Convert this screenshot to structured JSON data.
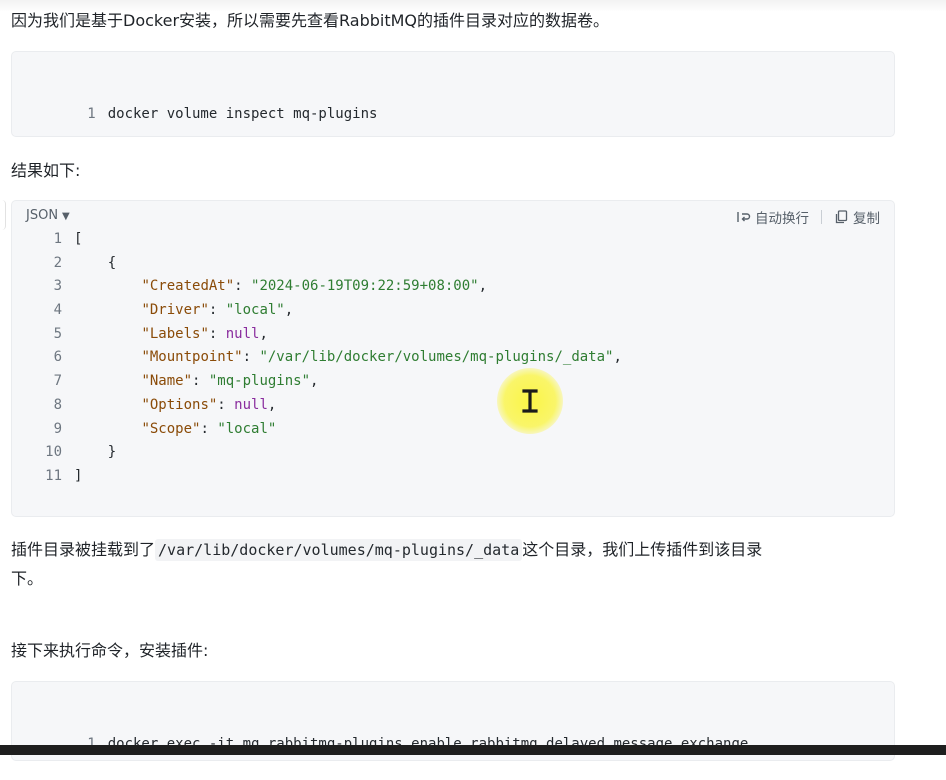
{
  "intro_text": "因为我们是基于Docker安装，所以需要先查看RabbitMQ的插件目录对应的数据卷。",
  "block1": {
    "lines": [
      {
        "num": "1",
        "text": "docker volume inspect mq-plugins"
      }
    ]
  },
  "result_label": "结果如下:",
  "json_block": {
    "lang": "JSON",
    "wrap_label": "自动换行",
    "copy_label": "复制",
    "lines": [
      {
        "num": "1",
        "indent": "",
        "open": "["
      },
      {
        "num": "2",
        "indent": "    ",
        "open": "{"
      },
      {
        "num": "3",
        "key": "\"CreatedAt\"",
        "val": "\"2024-06-19T09:22:59+08:00\"",
        "tail": ","
      },
      {
        "num": "4",
        "key": "\"Driver\"",
        "val": "\"local\"",
        "tail": ","
      },
      {
        "num": "5",
        "key": "\"Labels\"",
        "nul": "null",
        "tail": ","
      },
      {
        "num": "6",
        "key": "\"Mountpoint\"",
        "val": "\"/var/lib/docker/volumes/mq-plugins/_data\"",
        "tail": ","
      },
      {
        "num": "7",
        "key": "\"Name\"",
        "val": "\"mq-plugins\"",
        "tail": ","
      },
      {
        "num": "8",
        "key": "\"Options\"",
        "nul": "null",
        "tail": ","
      },
      {
        "num": "9",
        "key": "\"Scope\"",
        "val": "\"local\"",
        "tail": ""
      },
      {
        "num": "10",
        "indent": "    ",
        "open": "}"
      },
      {
        "num": "11",
        "indent": "",
        "open": "]"
      }
    ]
  },
  "mount_para": {
    "before": "插件目录被挂载到了",
    "code": "/var/lib/docker/volumes/mq-plugins/_data",
    "after": "这个目录，我们上传插件到该目录",
    "line2": "下。"
  },
  "next_label": "接下来执行命令，安装插件:",
  "block2": {
    "lines": [
      {
        "num": "1",
        "text": "docker exec -it mq rabbitmq-plugins enable rabbitmq_delayed_message_exchange"
      }
    ]
  }
}
